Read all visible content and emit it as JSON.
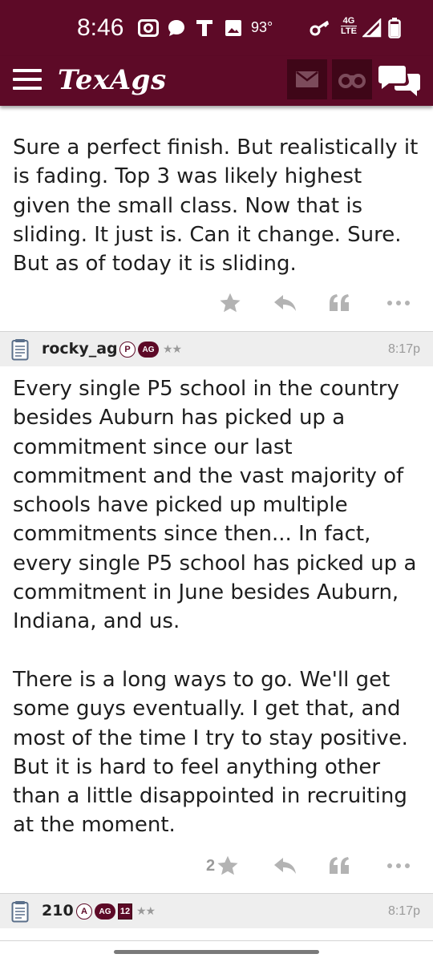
{
  "status_bar": {
    "time": "8:46",
    "temperature": "93°",
    "network_top": "4G",
    "network_bottom": "LTE",
    "icons": [
      "camera-icon",
      "message-bubble-icon",
      "t-mobile-icon",
      "image-icon",
      "key-icon",
      "signal-icon",
      "battery-icon"
    ]
  },
  "header": {
    "logo": "TexAgs",
    "buttons": [
      "menu-icon",
      "mail-icon",
      "binoculars-icon",
      "chat-icon"
    ]
  },
  "colors": {
    "brand": "#5d0a27",
    "brand_dark": "#3f0618",
    "action_gray": "#b3b3b3",
    "header_row_bg": "#eeeeee"
  },
  "posts": [
    {
      "body": "Sure a perfect finish. But realistically it is fading. Top 3 was likely highest given the small class. Now that is sliding. It just is. Can it change. Sure. But as of today it is sliding.",
      "star_count": ""
    },
    {
      "username": "rocky_ag",
      "badges": [
        "P",
        "AG"
      ],
      "stars": "★★",
      "time": "8:17p",
      "body_p1": "Every single P5 school in the country besides Auburn has picked up a commitment since our last commitment and the vast majority of schools have picked up multiple commitments since then... In fact, every single P5 school has picked up a commitment in June besides Auburn, Indiana, and us.",
      "body_p2": "There is a long ways to go. We'll get some guys eventually. I get that, and most of the time I try to stay positive. But it is hard to feel anything other than a little disappointed in recruiting at the moment.",
      "star_count": "2"
    },
    {
      "username": "210",
      "badges": [
        "A",
        "AG",
        "12"
      ],
      "stars": "★★",
      "time": "8:17p"
    }
  ]
}
